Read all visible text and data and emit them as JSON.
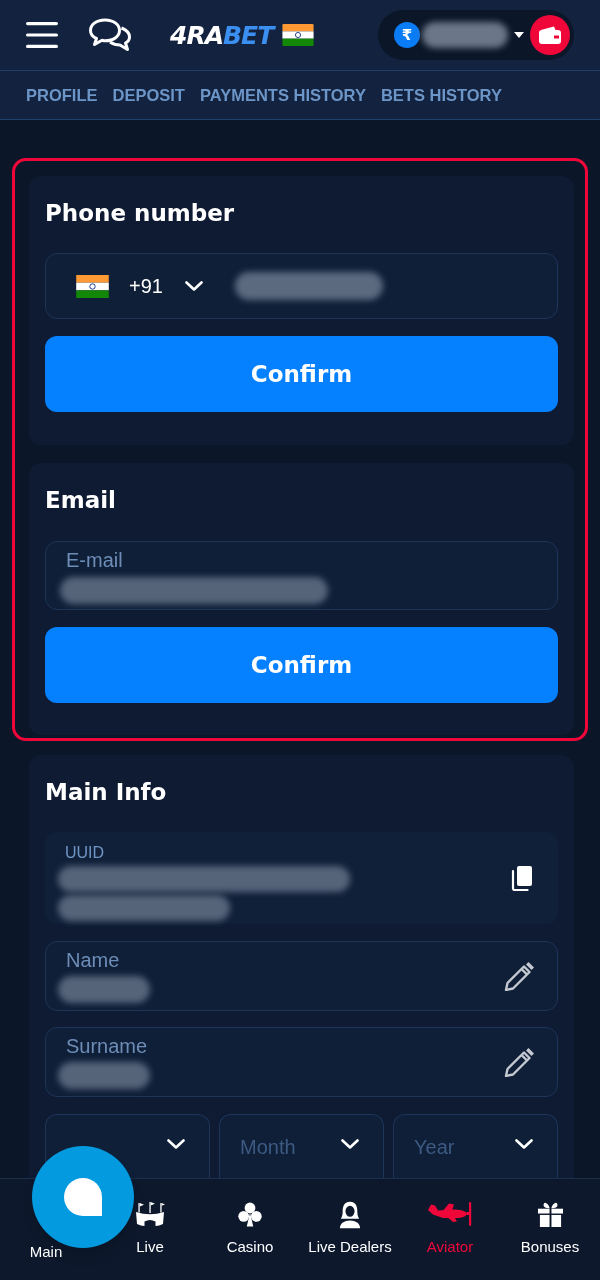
{
  "header": {
    "logo": [
      {
        "text": "4RA",
        "color": "#ffffff"
      },
      {
        "text": "BET",
        "color": "#3b8ff0"
      }
    ],
    "balance": {
      "currency_symbol": "₹"
    }
  },
  "tabs": [
    {
      "label": "PROFILE",
      "selected": false
    },
    {
      "label": "DEPOSIT",
      "selected": false
    },
    {
      "label": "PAYMENTS HISTORY",
      "selected": false
    },
    {
      "label": "BETS HISTORY",
      "selected": false
    }
  ],
  "verification": {
    "highlighted": true,
    "cards": [
      {
        "kind": "phone",
        "title": "Phone number",
        "country_code": "+91",
        "button": "Confirm"
      },
      {
        "kind": "email",
        "title": "Email",
        "field_label": "E-mail",
        "button": "Confirm"
      }
    ]
  },
  "main_info": {
    "title": "Main Info",
    "fields": [
      {
        "kind": "copyable",
        "label": "UUID"
      },
      {
        "kind": "editable",
        "label": "Name"
      },
      {
        "kind": "editable",
        "label": "Surname"
      }
    ],
    "date_selects": [
      {
        "placeholder": "Month"
      },
      {
        "placeholder": "Year"
      }
    ]
  },
  "bottom_nav": [
    {
      "label": "Main",
      "selected": false
    },
    {
      "label": "Live",
      "selected": false
    },
    {
      "label": "Casino",
      "selected": false
    },
    {
      "label": "Live Dealers",
      "selected": false
    },
    {
      "label": "Aviator",
      "selected": true
    },
    {
      "label": "Bonuses",
      "selected": false
    }
  ]
}
